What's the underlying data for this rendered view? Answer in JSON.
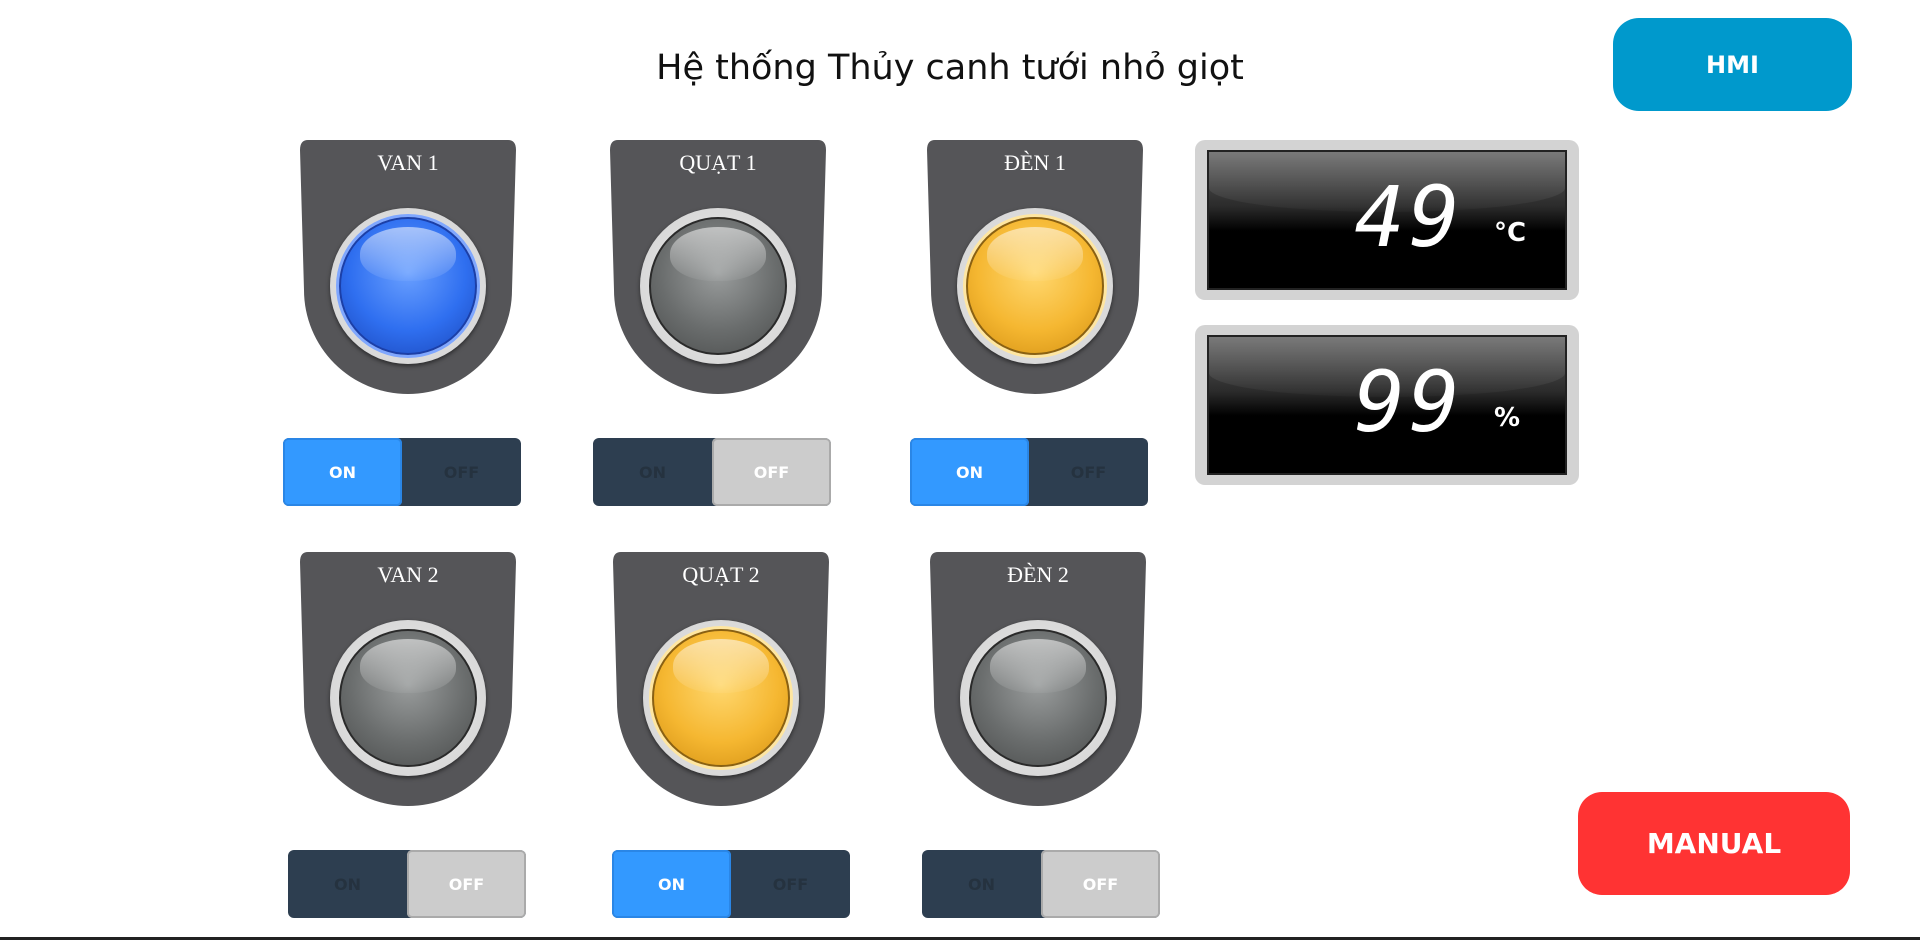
{
  "title": "Hệ thống Thủy canh tưới nhỏ giọt",
  "buttons": {
    "hmi": {
      "label": "HMI",
      "color": "#0099cc"
    },
    "manual": {
      "label": "MANUAL",
      "color": "#ff3333"
    }
  },
  "switch_labels": {
    "on": "ON",
    "off": "OFF"
  },
  "devices": [
    {
      "id": "van1",
      "label": "VAN 1",
      "lamp_on": true,
      "lamp_color": "blue",
      "switch_state": "ON"
    },
    {
      "id": "quat1",
      "label": "QUẠT 1",
      "lamp_on": false,
      "lamp_color": "gray",
      "switch_state": "OFF"
    },
    {
      "id": "den1",
      "label": "ĐÈN 1",
      "lamp_on": true,
      "lamp_color": "amber",
      "switch_state": "ON"
    },
    {
      "id": "van2",
      "label": "VAN 2",
      "lamp_on": false,
      "lamp_color": "gray",
      "switch_state": "OFF"
    },
    {
      "id": "quat2",
      "label": "QUẠT 2",
      "lamp_on": true,
      "lamp_color": "amber",
      "switch_state": "ON"
    },
    {
      "id": "den2",
      "label": "ĐÈN 2",
      "lamp_on": false,
      "lamp_color": "gray",
      "switch_state": "OFF"
    }
  ],
  "displays": {
    "temperature": {
      "value": "49",
      "unit": "°C"
    },
    "humidity": {
      "value": "99",
      "unit": "%"
    }
  },
  "colors": {
    "housing": "#555558",
    "switch_track": "#2d3e50",
    "switch_on": "#3399ff",
    "switch_off": "#cccccc",
    "lamp_blue": "#2f6ff0",
    "lamp_amber": "#f5b731",
    "lamp_gray": "#6a6d6d"
  }
}
